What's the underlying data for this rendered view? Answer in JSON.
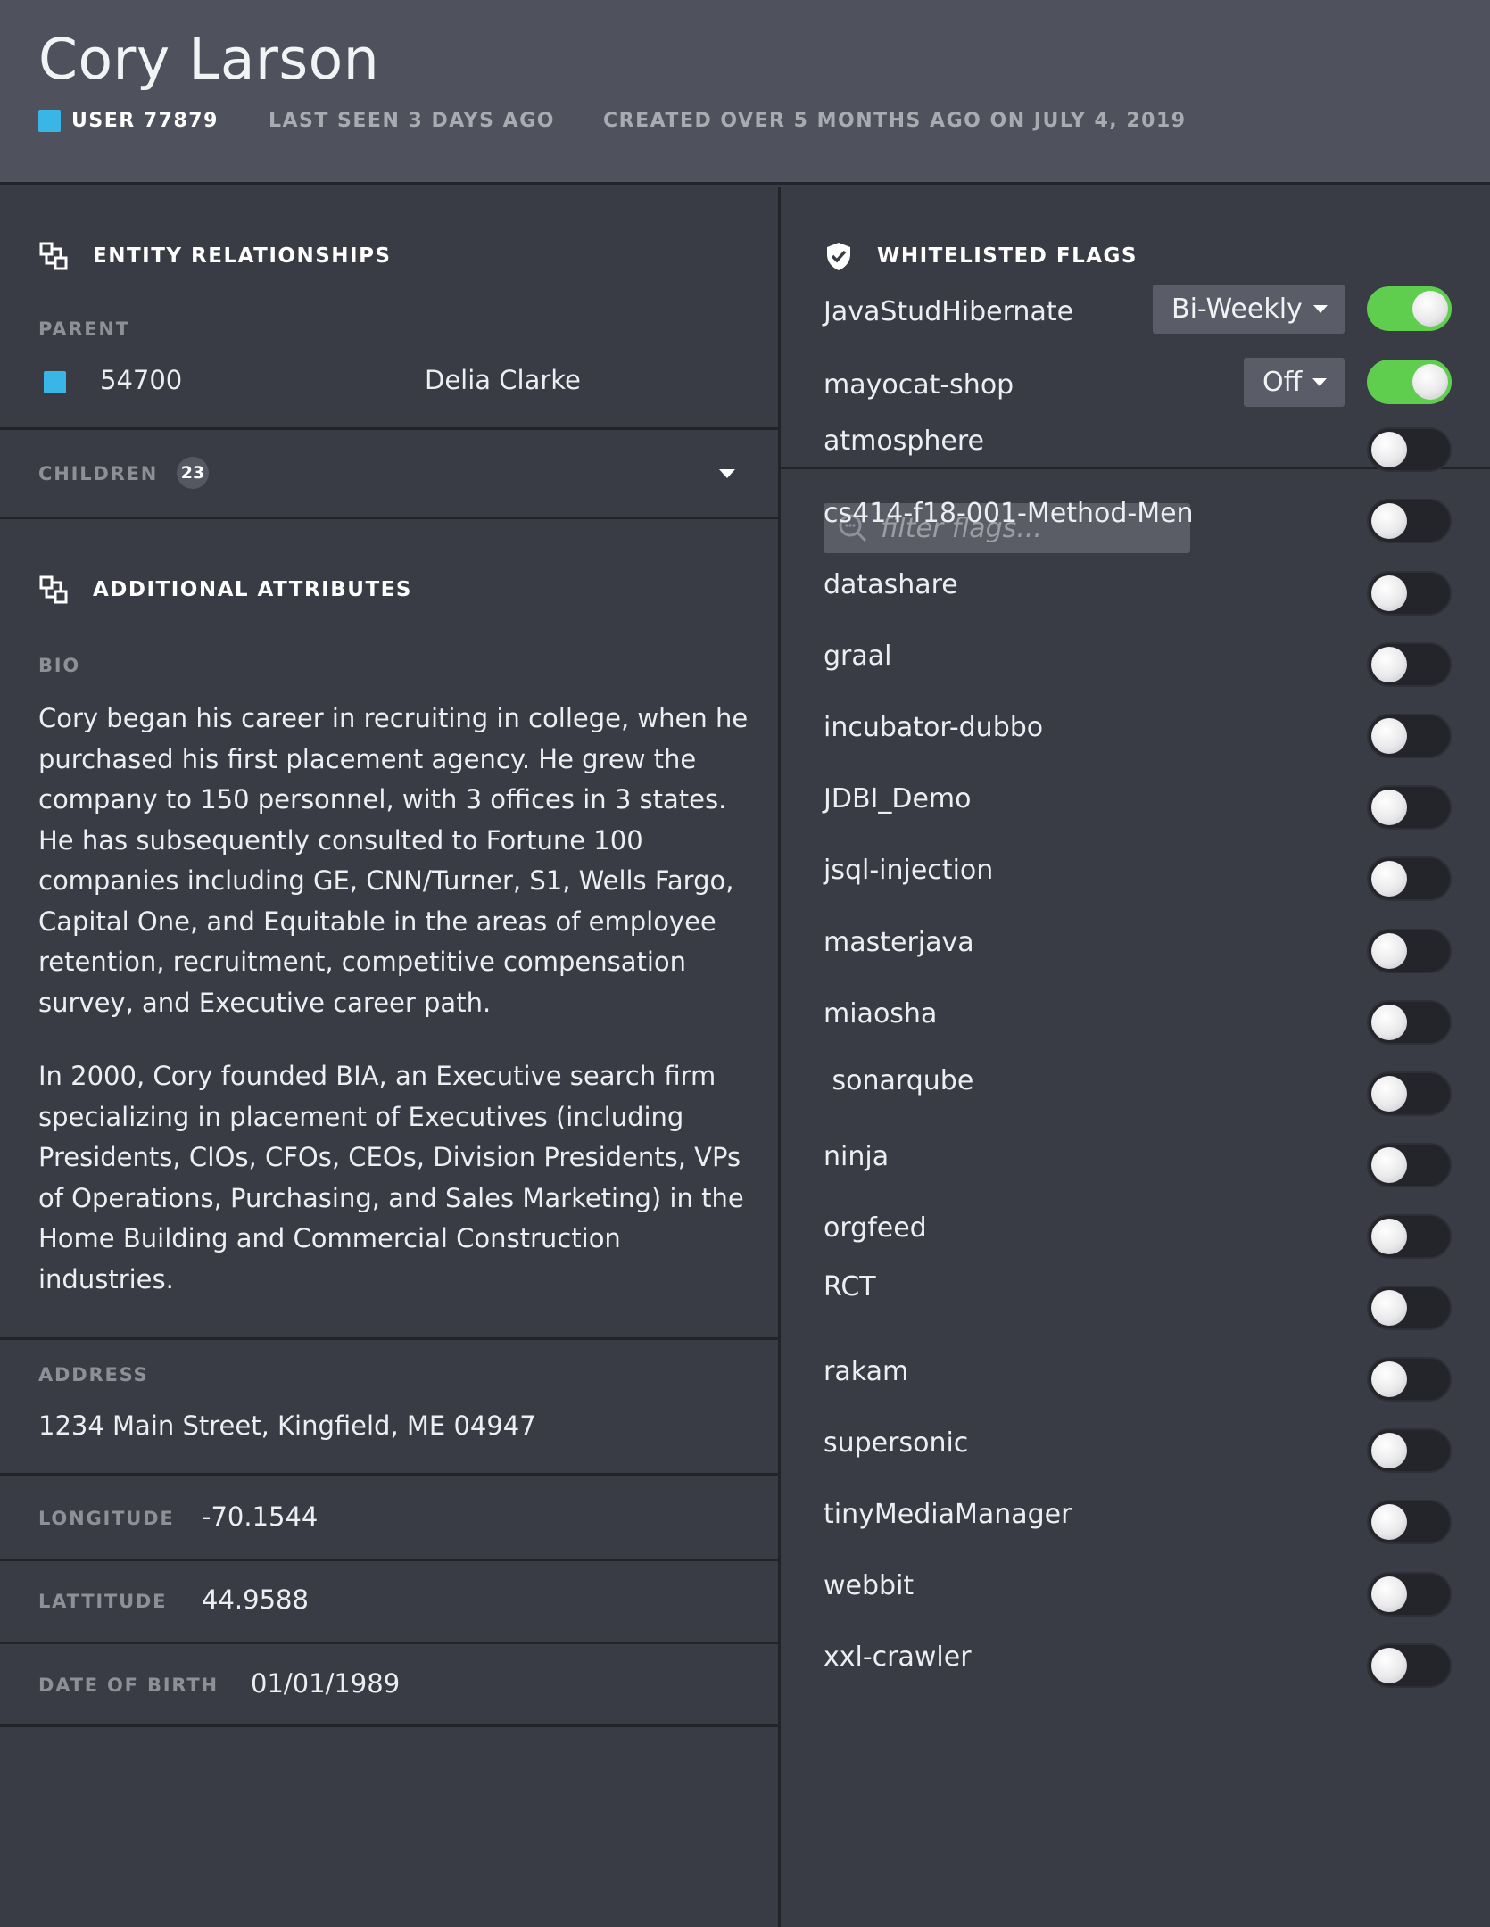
{
  "header": {
    "name": "Cory Larson",
    "user_id": "USER 77879",
    "last_seen": "LAST SEEN 3 DAYS AGO",
    "created": "CREATED OVER 5 MONTHS AGO ON JULY 4, 2019"
  },
  "relationships": {
    "title": "ENTITY RELATIONSHIPS",
    "parent_label": "PARENT",
    "parent_id": "54700",
    "parent_name": "Delia Clarke",
    "children_label": "CHILDREN",
    "children_count": "23"
  },
  "attributes": {
    "title": "ADDITIONAL ATTRIBUTES",
    "bio_label": "BIO",
    "bio_p1": "Cory began his career in recruiting in college, when he purchased his first placement agency. He grew the company to 150 personnel, with 3 offices in 3 states. He has subsequently consulted to Fortune 100 companies including GE, CNN/Turner, S1, Wells Fargo, Capital One, and Equitable in the areas of employee retention, recruitment, competitive compensation survey, and Executive career path.",
    "bio_p2": "In 2000, Cory founded BIA, an Executive search firm specializing in placement of Executives (including Presidents, CIOs, CFOs, CEOs, Division Presidents, VPs of Operations, Purchasing, and Sales Marketing) in the Home Building and Commercial Construction industries.",
    "address_label": "ADDRESS",
    "address": "1234 Main Street, Kingfield, ME 04947",
    "longitude_label": "LONGITUDE",
    "longitude": "-70.1544",
    "latitude_label": "LATTITUDE",
    "latitude": "44.9588",
    "dob_label": "DATE OF BIRTH",
    "dob": "01/01/1989"
  },
  "flags": {
    "title": "WHITELISTED FLAGS",
    "whitelisted": [
      {
        "name": "JavaStudHibernate",
        "frequency": "Bi-Weekly",
        "enabled": true
      },
      {
        "name": "mayocat-shop",
        "frequency": "Off",
        "enabled": true
      }
    ],
    "filter_placeholder": "filter flags...",
    "list": [
      {
        "name": "atmosphere",
        "enabled": false
      },
      {
        "name": "cs414-f18-001-Method-Men",
        "enabled": false
      },
      {
        "name": "datashare",
        "enabled": false
      },
      {
        "name": "graal",
        "enabled": false
      },
      {
        "name": "incubator-dubbo",
        "enabled": false
      },
      {
        "name": "JDBI_Demo",
        "enabled": false
      },
      {
        "name": "jsql-injection",
        "enabled": false
      },
      {
        "name": "masterjava",
        "enabled": false
      },
      {
        "name": "miaosha",
        "enabled": false
      },
      {
        "name": " sonarqube",
        "enabled": false
      },
      {
        "name": "ninja",
        "enabled": false
      },
      {
        "name": "orgfeed",
        "enabled": false
      },
      {
        "name": "RCT",
        "enabled": false
      },
      {
        "name": "rakam",
        "enabled": false
      },
      {
        "name": "supersonic",
        "enabled": false
      },
      {
        "name": "tinyMediaManager",
        "enabled": false
      },
      {
        "name": "webbit",
        "enabled": false
      },
      {
        "name": "xxl-crawler",
        "enabled": false
      }
    ]
  },
  "colors": {
    "accent": "#39b6e6",
    "toggle_on": "#5fcd4d",
    "background": "#3a3c45",
    "header_bg": "#4f515c"
  },
  "icons": {
    "relationships": "hierarchy-icon",
    "attributes": "hierarchy-icon",
    "flags": "shield-check-icon",
    "filter": "search-icon",
    "children": "chevron-down-icon"
  }
}
